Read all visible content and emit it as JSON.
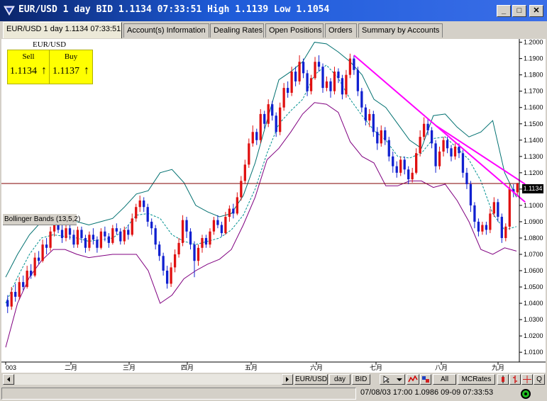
{
  "window": {
    "title": "EUR/USD 1 day BID 1.1134 07:33:51 High 1.1139 Low 1.1054",
    "controls": [
      "_",
      "□",
      "✕"
    ]
  },
  "tabs": [
    {
      "label": "EUR/USD 1 day 1.1134 07:33:51",
      "active": true
    },
    {
      "label": "Account(s) Information"
    },
    {
      "label": "Dealing Rates"
    },
    {
      "label": "Open Positions"
    },
    {
      "label": "Orders"
    },
    {
      "label": "Summary by Accounts"
    }
  ],
  "quote": {
    "symbol": "EUR/USD",
    "sell_label": "Sell",
    "buy_label": "Buy",
    "sell": "1.1134",
    "buy": "1.1137",
    "sell_arrow": "↑",
    "buy_arrow": "↑"
  },
  "indicator_label": "Bollinger Bands (13,5,2)",
  "current_price_tag": "1.1134",
  "chart_data": {
    "type": "candlestick",
    "y_ticks": [
      "1.2000",
      "1.1900",
      "1.1800",
      "1.1700",
      "1.1600",
      "1.1500",
      "1.1400",
      "1.1300",
      "1.1200",
      "1.1100",
      "1.1000",
      "1.0900",
      "1.0800",
      "1.0700",
      "1.0600",
      "1.0500",
      "1.0400",
      "1.0300",
      "1.0200",
      "1.0100"
    ],
    "ylim": [
      1.004,
      1.202
    ],
    "x_labels": [
      "003",
      "二月",
      "三月",
      "四月",
      "五月",
      "六月",
      "七月",
      "八月",
      "九月"
    ],
    "current_price": 1.1134,
    "bands": {
      "upper": [
        1.056,
        1.07,
        1.082,
        1.09,
        1.092,
        1.091,
        1.09,
        1.088,
        1.09,
        1.092,
        1.099,
        1.107,
        1.109,
        1.12,
        1.122,
        1.114,
        1.1,
        1.096,
        1.093,
        1.095,
        1.106,
        1.126,
        1.152,
        1.177,
        1.182,
        1.188,
        1.2,
        1.199,
        1.194,
        1.188,
        1.18,
        1.165,
        1.16,
        1.15,
        1.14,
        1.135,
        1.155,
        1.156,
        1.148,
        1.142,
        1.145,
        1.152,
        1.12,
        1.105
      ],
      "middle": [
        1.04,
        1.056,
        1.07,
        1.08,
        1.082,
        1.081,
        1.08,
        1.078,
        1.079,
        1.08,
        1.085,
        1.094,
        1.095,
        1.092,
        1.082,
        1.078,
        1.076,
        1.078,
        1.08,
        1.085,
        1.094,
        1.11,
        1.132,
        1.15,
        1.158,
        1.165,
        1.18,
        1.186,
        1.178,
        1.165,
        1.155,
        1.146,
        1.14,
        1.13,
        1.129,
        1.132,
        1.141,
        1.142,
        1.135,
        1.128,
        1.115,
        1.095,
        1.085,
        1.087
      ],
      "lower": [
        1.013,
        1.04,
        1.056,
        1.066,
        1.073,
        1.073,
        1.07,
        1.068,
        1.069,
        1.07,
        1.07,
        1.07,
        1.06,
        1.04,
        1.045,
        1.055,
        1.06,
        1.064,
        1.067,
        1.073,
        1.088,
        1.105,
        1.128,
        1.135,
        1.145,
        1.156,
        1.163,
        1.162,
        1.157,
        1.139,
        1.13,
        1.126,
        1.112,
        1.112,
        1.115,
        1.115,
        1.111,
        1.113,
        1.103,
        1.09,
        1.073,
        1.07,
        1.074,
        1.072
      ]
    },
    "candles": [
      [
        1.042,
        1.038,
        1.045,
        1.034
      ],
      [
        1.038,
        1.047,
        1.05,
        1.036
      ],
      [
        1.047,
        1.044,
        1.052,
        1.041
      ],
      [
        1.044,
        1.053,
        1.056,
        1.042
      ],
      [
        1.053,
        1.05,
        1.057,
        1.048
      ],
      [
        1.05,
        1.06,
        1.063,
        1.049
      ],
      [
        1.06,
        1.057,
        1.064,
        1.055
      ],
      [
        1.057,
        1.068,
        1.071,
        1.056
      ],
      [
        1.068,
        1.066,
        1.072,
        1.064
      ],
      [
        1.066,
        1.076,
        1.079,
        1.065
      ],
      [
        1.076,
        1.074,
        1.08,
        1.07
      ],
      [
        1.074,
        1.084,
        1.087,
        1.072
      ],
      [
        1.084,
        1.089,
        1.091,
        1.081
      ],
      [
        1.089,
        1.085,
        1.092,
        1.083
      ],
      [
        1.085,
        1.08,
        1.088,
        1.077
      ],
      [
        1.08,
        1.086,
        1.088,
        1.078
      ],
      [
        1.086,
        1.082,
        1.088,
        1.079
      ],
      [
        1.082,
        1.076,
        1.085,
        1.074
      ],
      [
        1.076,
        1.085,
        1.087,
        1.074
      ],
      [
        1.085,
        1.08,
        1.087,
        1.077
      ],
      [
        1.08,
        1.074,
        1.082,
        1.071
      ],
      [
        1.074,
        1.082,
        1.084,
        1.072
      ],
      [
        1.082,
        1.079,
        1.086,
        1.076
      ],
      [
        1.079,
        1.074,
        1.081,
        1.071
      ],
      [
        1.074,
        1.084,
        1.086,
        1.073
      ],
      [
        1.084,
        1.081,
        1.087,
        1.078
      ],
      [
        1.081,
        1.077,
        1.083,
        1.074
      ],
      [
        1.077,
        1.086,
        1.088,
        1.076
      ],
      [
        1.086,
        1.084,
        1.089,
        1.082
      ],
      [
        1.084,
        1.078,
        1.086,
        1.076
      ],
      [
        1.078,
        1.085,
        1.087,
        1.076
      ],
      [
        1.085,
        1.082,
        1.088,
        1.079
      ],
      [
        1.082,
        1.092,
        1.095,
        1.081
      ],
      [
        1.092,
        1.099,
        1.101,
        1.09
      ],
      [
        1.099,
        1.103,
        1.106,
        1.096
      ],
      [
        1.103,
        1.099,
        1.105,
        1.096
      ],
      [
        1.099,
        1.09,
        1.101,
        1.087
      ],
      [
        1.09,
        1.086,
        1.092,
        1.082
      ],
      [
        1.086,
        1.076,
        1.088,
        1.073
      ],
      [
        1.076,
        1.069,
        1.078,
        1.066
      ],
      [
        1.069,
        1.06,
        1.071,
        1.057
      ],
      [
        1.06,
        1.052,
        1.063,
        1.049
      ],
      [
        1.052,
        1.062,
        1.065,
        1.05
      ],
      [
        1.062,
        1.07,
        1.073,
        1.059
      ],
      [
        1.07,
        1.077,
        1.08,
        1.068
      ],
      [
        1.077,
        1.091,
        1.094,
        1.075
      ],
      [
        1.091,
        1.084,
        1.093,
        1.08
      ],
      [
        1.084,
        1.076,
        1.086,
        1.073
      ],
      [
        1.076,
        1.066,
        1.078,
        1.056
      ],
      [
        1.066,
        1.074,
        1.076,
        1.063
      ],
      [
        1.074,
        1.08,
        1.082,
        1.071
      ],
      [
        1.08,
        1.076,
        1.082,
        1.074
      ],
      [
        1.076,
        1.084,
        1.086,
        1.074
      ],
      [
        1.084,
        1.091,
        1.093,
        1.082
      ],
      [
        1.091,
        1.088,
        1.094,
        1.086
      ],
      [
        1.088,
        1.083,
        1.09,
        1.081
      ],
      [
        1.083,
        1.093,
        1.096,
        1.082
      ],
      [
        1.093,
        1.098,
        1.1,
        1.09
      ],
      [
        1.098,
        1.095,
        1.101,
        1.092
      ],
      [
        1.095,
        1.105,
        1.108,
        1.094
      ],
      [
        1.105,
        1.115,
        1.118,
        1.103
      ],
      [
        1.115,
        1.125,
        1.128,
        1.113
      ],
      [
        1.125,
        1.138,
        1.141,
        1.123
      ],
      [
        1.138,
        1.145,
        1.149,
        1.136
      ],
      [
        1.145,
        1.14,
        1.147,
        1.137
      ],
      [
        1.14,
        1.156,
        1.159,
        1.138
      ],
      [
        1.156,
        1.15,
        1.158,
        1.147
      ],
      [
        1.15,
        1.162,
        1.165,
        1.148
      ],
      [
        1.162,
        1.155,
        1.164,
        1.152
      ],
      [
        1.155,
        1.145,
        1.157,
        1.142
      ],
      [
        1.145,
        1.16,
        1.163,
        1.143
      ],
      [
        1.16,
        1.172,
        1.175,
        1.158
      ],
      [
        1.172,
        1.169,
        1.176,
        1.166
      ],
      [
        1.169,
        1.182,
        1.185,
        1.167
      ],
      [
        1.182,
        1.176,
        1.185,
        1.173
      ],
      [
        1.176,
        1.188,
        1.192,
        1.174
      ],
      [
        1.188,
        1.181,
        1.19,
        1.178
      ],
      [
        1.181,
        1.17,
        1.183,
        1.167
      ],
      [
        1.17,
        1.178,
        1.18,
        1.168
      ],
      [
        1.178,
        1.188,
        1.191,
        1.177
      ],
      [
        1.188,
        1.185,
        1.192,
        1.182
      ],
      [
        1.185,
        1.172,
        1.187,
        1.169
      ],
      [
        1.172,
        1.176,
        1.179,
        1.17
      ],
      [
        1.176,
        1.17,
        1.178,
        1.166
      ],
      [
        1.17,
        1.182,
        1.185,
        1.168
      ],
      [
        1.182,
        1.178,
        1.184,
        1.175
      ],
      [
        1.178,
        1.168,
        1.18,
        1.165
      ],
      [
        1.168,
        1.18,
        1.183,
        1.166
      ],
      [
        1.18,
        1.19,
        1.193,
        1.178
      ],
      [
        1.19,
        1.183,
        1.192,
        1.18
      ],
      [
        1.183,
        1.17,
        1.185,
        1.167
      ],
      [
        1.17,
        1.16,
        1.172,
        1.157
      ],
      [
        1.16,
        1.152,
        1.162,
        1.149
      ],
      [
        1.152,
        1.156,
        1.159,
        1.148
      ],
      [
        1.156,
        1.145,
        1.158,
        1.142
      ],
      [
        1.145,
        1.138,
        1.148,
        1.134
      ],
      [
        1.138,
        1.146,
        1.149,
        1.136
      ],
      [
        1.146,
        1.14,
        1.148,
        1.137
      ],
      [
        1.14,
        1.13,
        1.142,
        1.127
      ],
      [
        1.13,
        1.124,
        1.133,
        1.12
      ],
      [
        1.124,
        1.12,
        1.127,
        1.117
      ],
      [
        1.12,
        1.128,
        1.13,
        1.118
      ],
      [
        1.128,
        1.122,
        1.13,
        1.119
      ],
      [
        1.122,
        1.116,
        1.124,
        1.113
      ],
      [
        1.116,
        1.12,
        1.123,
        1.114
      ],
      [
        1.12,
        1.132,
        1.135,
        1.119
      ],
      [
        1.132,
        1.142,
        1.146,
        1.13
      ],
      [
        1.142,
        1.15,
        1.154,
        1.14
      ],
      [
        1.15,
        1.146,
        1.153,
        1.143
      ],
      [
        1.146,
        1.138,
        1.148,
        1.135
      ],
      [
        1.138,
        1.124,
        1.14,
        1.12
      ],
      [
        1.124,
        1.133,
        1.136,
        1.122
      ],
      [
        1.133,
        1.14,
        1.142,
        1.13
      ],
      [
        1.14,
        1.135,
        1.142,
        1.132
      ],
      [
        1.135,
        1.13,
        1.137,
        1.127
      ],
      [
        1.13,
        1.136,
        1.138,
        1.128
      ],
      [
        1.136,
        1.132,
        1.138,
        1.129
      ],
      [
        1.132,
        1.12,
        1.134,
        1.117
      ],
      [
        1.12,
        1.113,
        1.123,
        1.11
      ],
      [
        1.113,
        1.1,
        1.115,
        1.096
      ],
      [
        1.1,
        1.09,
        1.102,
        1.086
      ],
      [
        1.09,
        1.084,
        1.092,
        1.081
      ],
      [
        1.084,
        1.088,
        1.09,
        1.082
      ],
      [
        1.088,
        1.085,
        1.09,
        1.082
      ],
      [
        1.085,
        1.095,
        1.098,
        1.083
      ],
      [
        1.095,
        1.102,
        1.105,
        1.093
      ],
      [
        1.102,
        1.093,
        1.104,
        1.09
      ],
      [
        1.093,
        1.08,
        1.095,
        1.077
      ],
      [
        1.08,
        1.087,
        1.089,
        1.078
      ],
      [
        1.087,
        1.11,
        1.113,
        1.085
      ],
      [
        1.11,
        1.108,
        1.113,
        1.105
      ],
      [
        1.108,
        1.1134,
        1.1139,
        1.1054
      ]
    ]
  },
  "trendlines": [
    {
      "x0": 89,
      "y0": 1.192,
      "x1": 133,
      "y1": 1.102
    },
    {
      "x0": 110,
      "y0": 1.149,
      "x1": 133,
      "y1": 1.113
    }
  ],
  "toolbar": {
    "symbol_button": "EUR/USD",
    "period_button": "day",
    "price_button": "BID",
    "all_button": "All",
    "mcrates_button": "MCRates",
    "q_button": "Q"
  },
  "status": {
    "text": "07/08/03 17:00   1.0986 09-09 07:33:53"
  },
  "colors": {
    "up_candle": "#e01010",
    "down_candle": "#1020d0",
    "upper_band": "#007070",
    "middle_band": "#009090",
    "lower_band": "#800080",
    "trendline": "#ff00ff",
    "price_line": "#800000"
  }
}
